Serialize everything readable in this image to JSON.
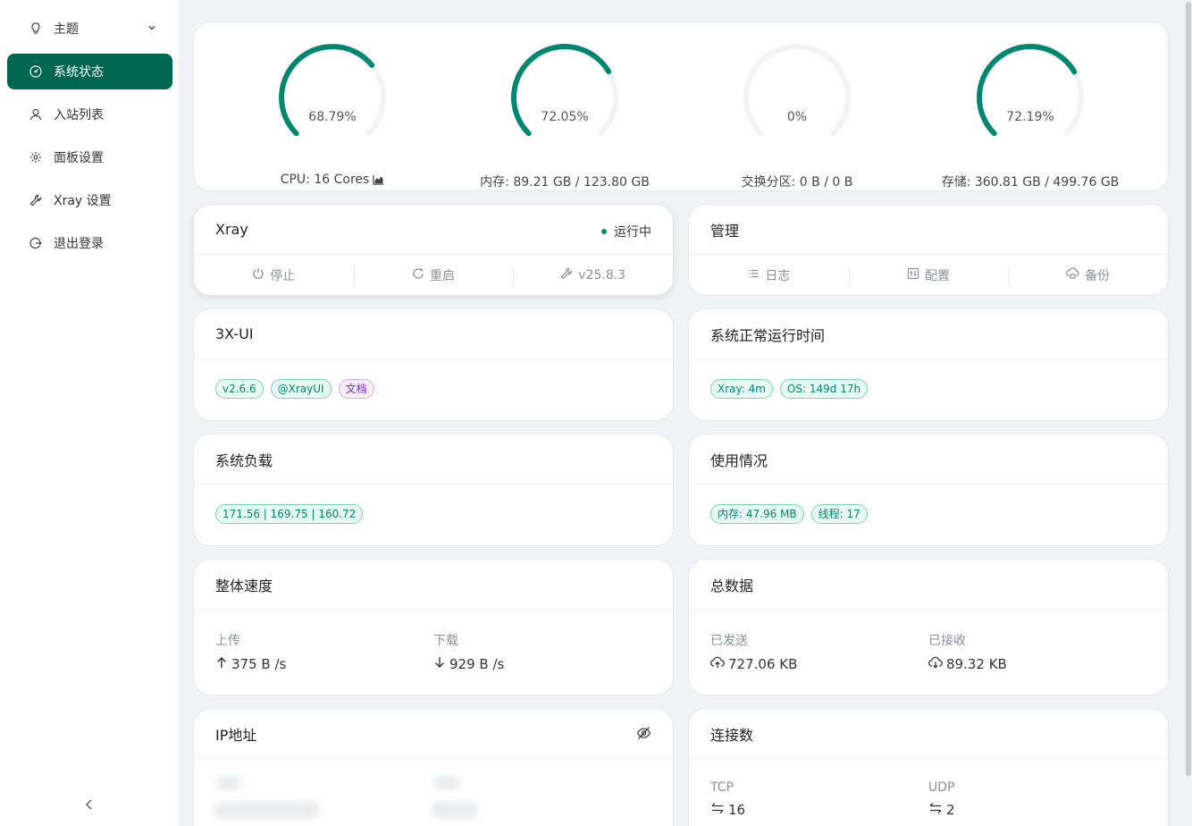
{
  "sidebar": {
    "items": [
      {
        "label": "主题",
        "icon": "bulb-icon"
      },
      {
        "label": "系统状态",
        "icon": "dashboard-icon",
        "active": true
      },
      {
        "label": "入站列表",
        "icon": "user-icon"
      },
      {
        "label": "面板设置",
        "icon": "gear-icon"
      },
      {
        "label": "Xray 设置",
        "icon": "wrench-icon"
      },
      {
        "label": "退出登录",
        "icon": "logout-icon"
      }
    ]
  },
  "gauges": [
    {
      "percent": 68.79,
      "text": "68.79%",
      "label": "CPU: 16 Cores"
    },
    {
      "percent": 72.05,
      "text": "72.05%",
      "label": "内存: 89.21 GB / 123.80 GB"
    },
    {
      "percent": 0,
      "text": "0%",
      "label": "交换分区: 0 B / 0 B"
    },
    {
      "percent": 72.19,
      "text": "72.19%",
      "label": "存储: 360.81 GB / 499.76 GB"
    }
  ],
  "xray": {
    "title": "Xray",
    "status": "运行中",
    "actions": {
      "stop": "停止",
      "restart": "重启",
      "version": "v25.8.3"
    }
  },
  "manage": {
    "title": "管理",
    "actions": {
      "logs": "日志",
      "config": "配置",
      "backup": "备份"
    }
  },
  "panel": {
    "title": "3X-UI",
    "tags": {
      "version": "v2.6.6",
      "channel": "@XrayUI",
      "docs": "文档"
    }
  },
  "uptime": {
    "title": "系统正常运行时间",
    "tags": {
      "xray": "Xray: 4m",
      "os": "OS: 149d 17h"
    }
  },
  "load": {
    "title": "系统负载",
    "tag": "171.56 | 169.75 | 160.72"
  },
  "usage": {
    "title": "使用情况",
    "tags": {
      "mem": "内存: 47.96 MB",
      "threads": "线程: 17"
    }
  },
  "speed": {
    "title": "整体速度",
    "up_label": "上传",
    "up_value": "375 B /s",
    "down_label": "下载",
    "down_value": "929 B /s"
  },
  "traffic": {
    "title": "总数据",
    "sent_label": "已发送",
    "sent_value": "727.06 KB",
    "recv_label": "已接收",
    "recv_value": "89.32 KB"
  },
  "ip": {
    "title": "IP地址"
  },
  "connections": {
    "title": "连接数",
    "tcp_label": "TCP",
    "tcp_value": "16",
    "udp_label": "UDP",
    "udp_value": "2"
  },
  "colors": {
    "accent": "#00664f",
    "gauge": "#008771",
    "track": "#f2f3f5"
  }
}
